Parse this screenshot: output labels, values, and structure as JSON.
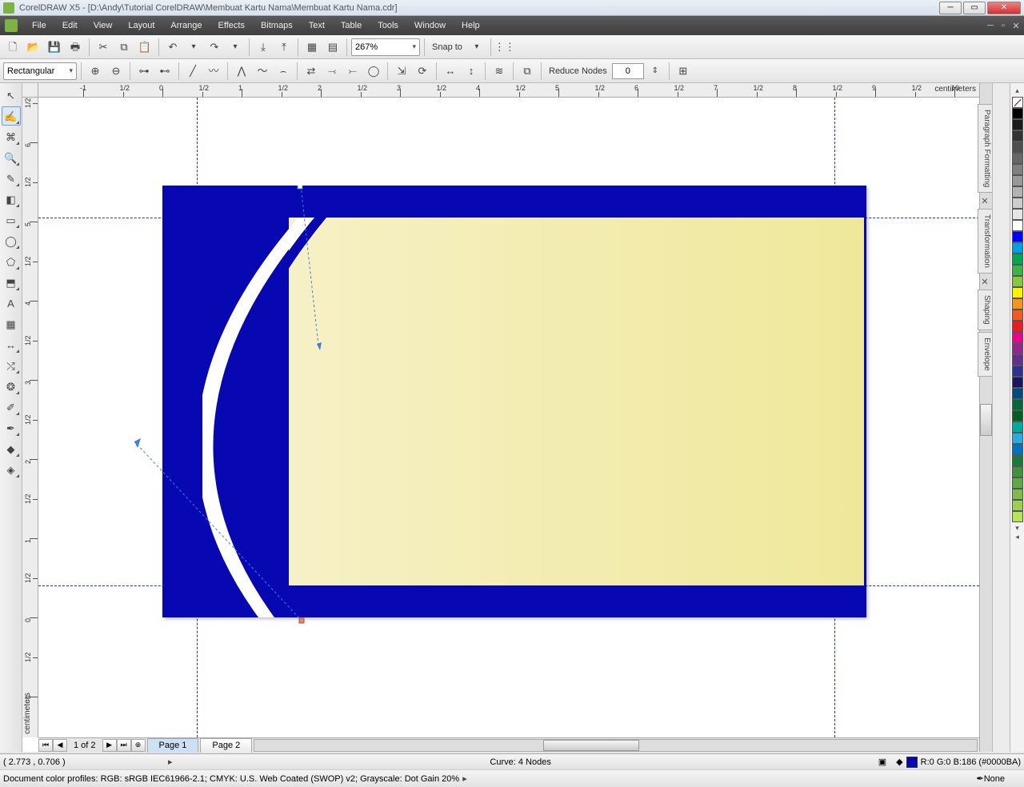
{
  "titlebar": {
    "text": "CorelDRAW X5 - [D:\\Andy\\Tutorial CorelDRAW\\Membuat Kartu Nama\\Membuat Kartu Nama.cdr]"
  },
  "menu": {
    "items": [
      "File",
      "Edit",
      "View",
      "Layout",
      "Arrange",
      "Effects",
      "Bitmaps",
      "Text",
      "Table",
      "Tools",
      "Window",
      "Help"
    ]
  },
  "toolbar": {
    "zoom_value": "267%",
    "snap_label": "Snap to"
  },
  "propbar": {
    "shape_dropdown": "Rectangular",
    "reduce_label": "Reduce Nodes",
    "reduce_value": "0"
  },
  "ruler": {
    "units": "centimeters"
  },
  "pages": {
    "counter": "1 of 2",
    "tabs": [
      "Page 1",
      "Page 2"
    ]
  },
  "status": {
    "cursor": "( 2.773 , 0.706 )",
    "object": "Curve: 4 Nodes",
    "fill": "R:0 G:0 B:186 (#0000BA)",
    "outline": "None",
    "profiles": "Document color profiles: RGB: sRGB IEC61966-2.1; CMYK: U.S. Web Coated (SWOP) v2; Grayscale: Dot Gain 20%"
  },
  "dockers": [
    "Paragraph Formatting",
    "Transformation",
    "Shaping",
    "Envelope"
  ],
  "palette": [
    "#000000",
    "#1a1a1a",
    "#333333",
    "#4d4d4d",
    "#666666",
    "#808080",
    "#999999",
    "#b3b3b3",
    "#cccccc",
    "#e6e6e6",
    "#ffffff",
    "#0000ff",
    "#009fe3",
    "#00a651",
    "#39b54a",
    "#8cc63f",
    "#fff200",
    "#f7941d",
    "#f15a24",
    "#ed1c24",
    "#ec008c",
    "#92278f",
    "#662d91",
    "#2e3192",
    "#1b1464",
    "#004a80",
    "#006837",
    "#005e20",
    "#00a99d",
    "#29abe2",
    "#0071bc",
    "#1a7a3a",
    "#41923c",
    "#5fa845",
    "#7dbb4c",
    "#9bcf54",
    "#b9e25b"
  ]
}
